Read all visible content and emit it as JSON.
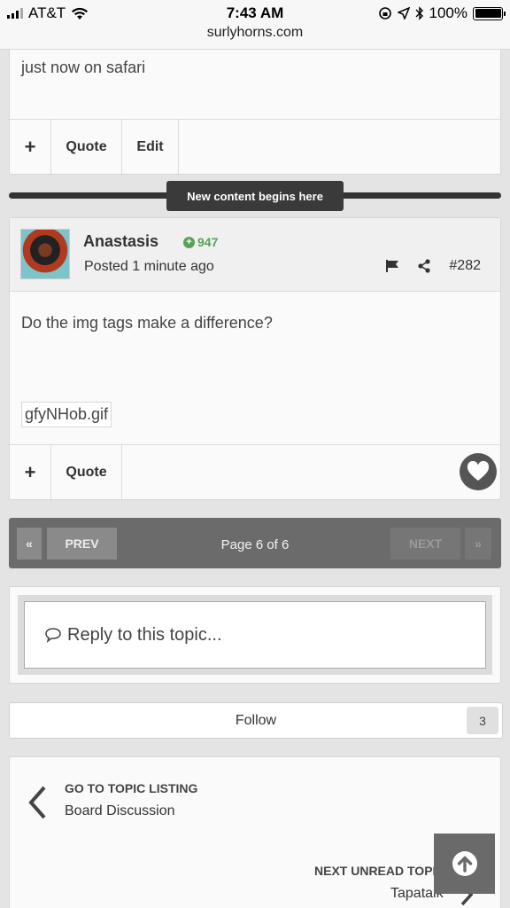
{
  "status_bar": {
    "carrier": "AT&T",
    "time": "7:43 AM",
    "battery": "100%",
    "url": "surlyhorns.com"
  },
  "previous_post": {
    "text": "just now on safari",
    "actions": {
      "plus": "+",
      "quote": "Quote",
      "edit": "Edit"
    }
  },
  "divider": {
    "label": "New content begins here"
  },
  "post": {
    "author": "Anastasis",
    "reputation": "947",
    "posted": "Posted 1 minute ago",
    "number": "#282",
    "body": "Do the img tags make a difference?",
    "attachment": "gfyNHob.gif",
    "actions": {
      "plus": "+",
      "quote": "Quote"
    }
  },
  "pagination": {
    "first": "«",
    "prev": "PREV",
    "label": "Page 6 of 6",
    "next": "NEXT",
    "last": "»"
  },
  "reply": {
    "placeholder": "Reply to this topic..."
  },
  "follow": {
    "label": "Follow",
    "count": "3"
  },
  "navigation": {
    "back_title": "GO TO TOPIC LISTING",
    "back_sub": "Board Discussion",
    "next_title": "NEXT UNREAD TOPIC",
    "next_sub": "Tapatalk"
  },
  "colors": {
    "reputation": "#5aa05a",
    "pager_bg": "#6b6b6b",
    "divider": "#333333"
  },
  "icons": {
    "wifi": "wifi-icon",
    "location": "location-arrow-icon",
    "bluetooth": "bluetooth-icon",
    "flag": "flag-icon",
    "share": "share-icon",
    "heart": "heart-icon",
    "speech": "speech-bubble-icon",
    "back": "chevron-left-icon",
    "next": "chevron-right-icon",
    "up": "arrow-up-circle-icon"
  }
}
